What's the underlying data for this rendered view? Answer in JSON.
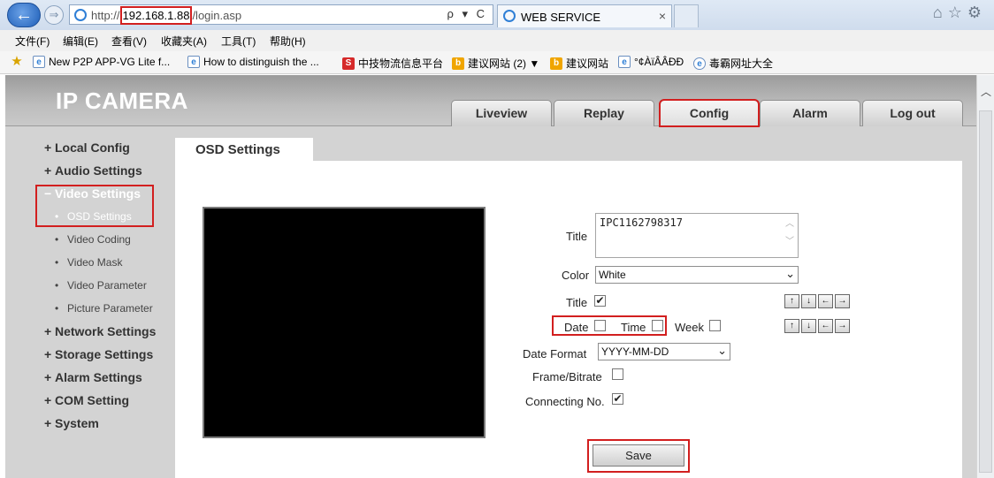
{
  "browser": {
    "url_prefix": "http://",
    "url_host": "192.168.1.88",
    "url_path": "/login.asp",
    "url_controls": "ρ ▾ C",
    "tab_title": "WEB SERVICE",
    "tab_close": "×",
    "menu": [
      "文件(F)",
      "编辑(E)",
      "查看(V)",
      "收藏夹(A)",
      "工具(T)",
      "帮助(H)"
    ],
    "favorites": [
      {
        "icon": "page-icon",
        "label": "New P2P APP-VG Lite f..."
      },
      {
        "icon": "page-icon",
        "label": "How to distinguish the ..."
      },
      {
        "icon": "s-icon",
        "label": "中技物流信息平台"
      },
      {
        "icon": "bing-icon",
        "label": "建议网站 (2) ▼"
      },
      {
        "icon": "bing-icon",
        "label": "建议网站"
      },
      {
        "icon": "page-icon",
        "label": "°¢ÀïÂÂÐÐ"
      },
      {
        "icon": "ie-icon",
        "label": "毒霸网址大全"
      }
    ]
  },
  "app": {
    "brand": "IP CAMERA",
    "nav": [
      "Liveview",
      "Replay",
      "Config",
      "Alarm",
      "Log out"
    ],
    "active_nav": "Config"
  },
  "sidebar": {
    "local": "Local Config",
    "audio": "Audio Settings",
    "video": "Video Settings",
    "video_sub": [
      "OSD Settings",
      "Video Coding",
      "Video Mask",
      "Video Parameter",
      "Picture Parameter"
    ],
    "network": "Network Settings",
    "storage": "Storage Settings",
    "alarm": "Alarm Settings",
    "com": "COM Setting",
    "system": "System",
    "plus": "+",
    "minus": "−",
    "bullet": "•"
  },
  "osd": {
    "tab_title": "OSD Settings",
    "title_label": "Title",
    "title_value": "IPC1162798317",
    "color_label": "Color",
    "color_value": "White",
    "title_show_label": "Title",
    "title_show_checked": "✔",
    "date_label": "Date",
    "time_label": "Time",
    "week_label": "Week",
    "date_format_label": "Date Format",
    "date_format_value": "YYYY-MM-DD",
    "frame_bitrate_label": "Frame/Bitrate",
    "connecting_label": "Connecting No.",
    "connecting_checked": "✔",
    "save_label": "Save",
    "arrow_up": "↑",
    "arrow_down": "↓",
    "arrow_left": "←",
    "arrow_right": "→"
  },
  "colors": {
    "highlight": "#d21f1f",
    "sidebar_bg": "#d3d3d3",
    "header_bg": "#9b9b9b"
  }
}
